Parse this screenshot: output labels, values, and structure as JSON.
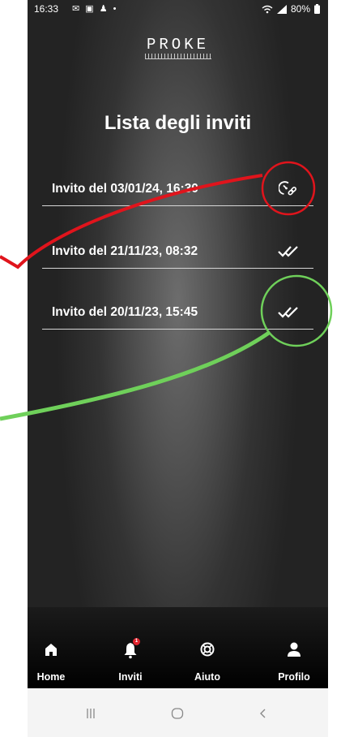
{
  "status_bar": {
    "time": "16:33",
    "notif_icons": "✉ ▣ ♟ •",
    "battery": "80%"
  },
  "app": {
    "logo": "PROKE",
    "title": "Lista degli inviti"
  },
  "invites": [
    {
      "label": "Invito del 03/01/24, 16:30",
      "status_icon": "timer-link-icon"
    },
    {
      "label": "Invito del 21/11/23, 08:32",
      "status_icon": "double-check-icon"
    },
    {
      "label": "Invito del 20/11/23, 15:45",
      "status_icon": "double-check-icon"
    }
  ],
  "bottom_nav": {
    "home": "Home",
    "invites": "Inviti",
    "invites_badge": "1",
    "help": "Aiuto",
    "profile": "Profilo"
  },
  "system_nav": {
    "recents": "recents-icon",
    "home": "home-circle-icon",
    "back": "back-icon"
  },
  "annotations": {
    "red": "#e0141c",
    "green": "#6fd05a"
  }
}
